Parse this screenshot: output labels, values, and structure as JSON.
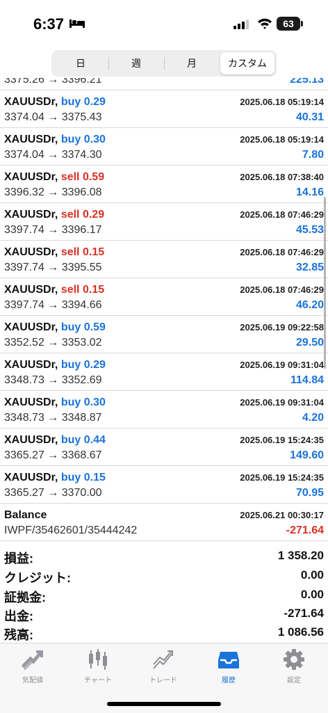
{
  "status_bar": {
    "time": "6:37",
    "battery": "63"
  },
  "segments": [
    {
      "label": "日",
      "active": false
    },
    {
      "label": "週",
      "active": false
    },
    {
      "label": "月",
      "active": false
    },
    {
      "label": "カスタム",
      "active": true
    }
  ],
  "partial_row": {
    "prices": "3375.26 → 3396.21",
    "profit": "225.13"
  },
  "trades": [
    {
      "symbol": "XAUUSDr,",
      "direction": "buy",
      "volume": "0.29",
      "datetime": "2025.06.18 05:19:14",
      "prices": "3374.04 → 3375.43",
      "profit": "40.31"
    },
    {
      "symbol": "XAUUSDr,",
      "direction": "buy",
      "volume": "0.30",
      "datetime": "2025.06.18 05:19:14",
      "prices": "3374.04 → 3374.30",
      "profit": "7.80"
    },
    {
      "symbol": "XAUUSDr,",
      "direction": "sell",
      "volume": "0.59",
      "datetime": "2025.06.18 07:38:40",
      "prices": "3396.32 → 3396.08",
      "profit": "14.16"
    },
    {
      "symbol": "XAUUSDr,",
      "direction": "sell",
      "volume": "0.29",
      "datetime": "2025.06.18 07:46:29",
      "prices": "3397.74 → 3396.17",
      "profit": "45.53"
    },
    {
      "symbol": "XAUUSDr,",
      "direction": "sell",
      "volume": "0.15",
      "datetime": "2025.06.18 07:46:29",
      "prices": "3397.74 → 3395.55",
      "profit": "32.85"
    },
    {
      "symbol": "XAUUSDr,",
      "direction": "sell",
      "volume": "0.15",
      "datetime": "2025.06.18 07:46:29",
      "prices": "3397.74 → 3394.66",
      "profit": "46.20"
    },
    {
      "symbol": "XAUUSDr,",
      "direction": "buy",
      "volume": "0.59",
      "datetime": "2025.06.19 09:22:58",
      "prices": "3352.52 → 3353.02",
      "profit": "29.50"
    },
    {
      "symbol": "XAUUSDr,",
      "direction": "buy",
      "volume": "0.29",
      "datetime": "2025.06.19 09:31:04",
      "prices": "3348.73 → 3352.69",
      "profit": "114.84"
    },
    {
      "symbol": "XAUUSDr,",
      "direction": "buy",
      "volume": "0.30",
      "datetime": "2025.06.19 09:31:04",
      "prices": "3348.73 → 3348.87",
      "profit": "4.20"
    },
    {
      "symbol": "XAUUSDr,",
      "direction": "buy",
      "volume": "0.44",
      "datetime": "2025.06.19 15:24:35",
      "prices": "3365.27 → 3368.67",
      "profit": "149.60"
    },
    {
      "symbol": "XAUUSDr,",
      "direction": "buy",
      "volume": "0.15",
      "datetime": "2025.06.19 15:24:35",
      "prices": "3365.27 → 3370.00",
      "profit": "70.95"
    }
  ],
  "balance": {
    "title": "Balance",
    "datetime": "2025.06.21 00:30:17",
    "comment": "IWPF/35462601/35444242",
    "amount": "-271.64"
  },
  "summary": [
    {
      "label": "損益:",
      "value": "1 358.20"
    },
    {
      "label": "クレジット:",
      "value": "0.00"
    },
    {
      "label": "証拠金:",
      "value": "0.00"
    },
    {
      "label": "出金:",
      "value": "-271.64"
    },
    {
      "label": "残高:",
      "value": "1 086.56"
    }
  ],
  "tabs": [
    {
      "label": "気配値",
      "icon": "quotes-icon",
      "active": false
    },
    {
      "label": "チャート",
      "icon": "chart-icon",
      "active": false
    },
    {
      "label": "トレード",
      "icon": "trade-icon",
      "active": false
    },
    {
      "label": "履歴",
      "icon": "history-icon",
      "active": true
    },
    {
      "label": "設定",
      "icon": "settings-icon",
      "active": false
    }
  ],
  "colors": {
    "buy": "#1a73d9",
    "sell": "#d93025",
    "profit": "#1a73d9",
    "loss": "#d93025",
    "active_tab": "#1a73d9"
  }
}
